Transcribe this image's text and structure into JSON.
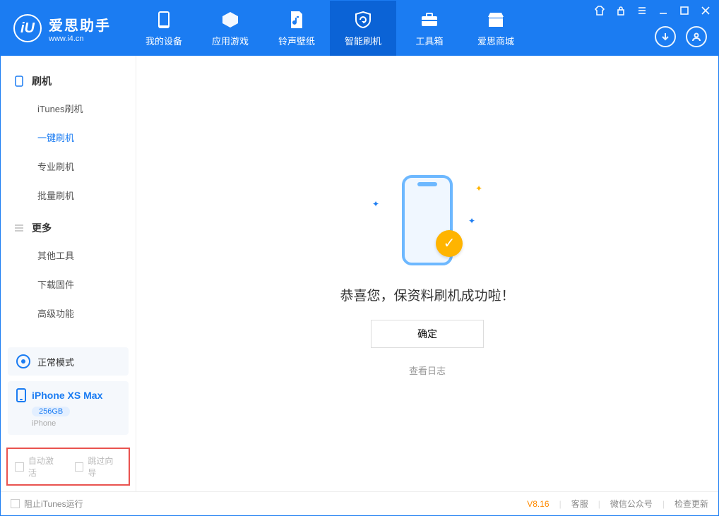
{
  "app": {
    "name_cn": "爱思助手",
    "name_url": "www.i4.cn",
    "logo_letter": "iU"
  },
  "tabs": {
    "device": "我的设备",
    "apps": "应用游戏",
    "ring": "铃声壁纸",
    "flash": "智能刷机",
    "toolbox": "工具箱",
    "store": "爱思商城"
  },
  "sidebar": {
    "section_flash": "刷机",
    "items_flash": {
      "itunes": "iTunes刷机",
      "onekey": "一键刷机",
      "pro": "专业刷机",
      "batch": "批量刷机"
    },
    "section_more": "更多",
    "items_more": {
      "other": "其他工具",
      "firmware": "下载固件",
      "advanced": "高级功能"
    }
  },
  "device": {
    "mode": "正常模式",
    "name": "iPhone XS Max",
    "capacity": "256GB",
    "type": "iPhone"
  },
  "options": {
    "auto_activate": "自动激活",
    "skip_guide": "跳过向导"
  },
  "main": {
    "success_msg": "恭喜您，保资料刷机成功啦！",
    "ok": "确定",
    "view_log": "查看日志"
  },
  "status": {
    "block_itunes": "阻止iTunes运行",
    "version": "V8.16",
    "support": "客服",
    "wechat": "微信公众号",
    "update": "检查更新"
  }
}
